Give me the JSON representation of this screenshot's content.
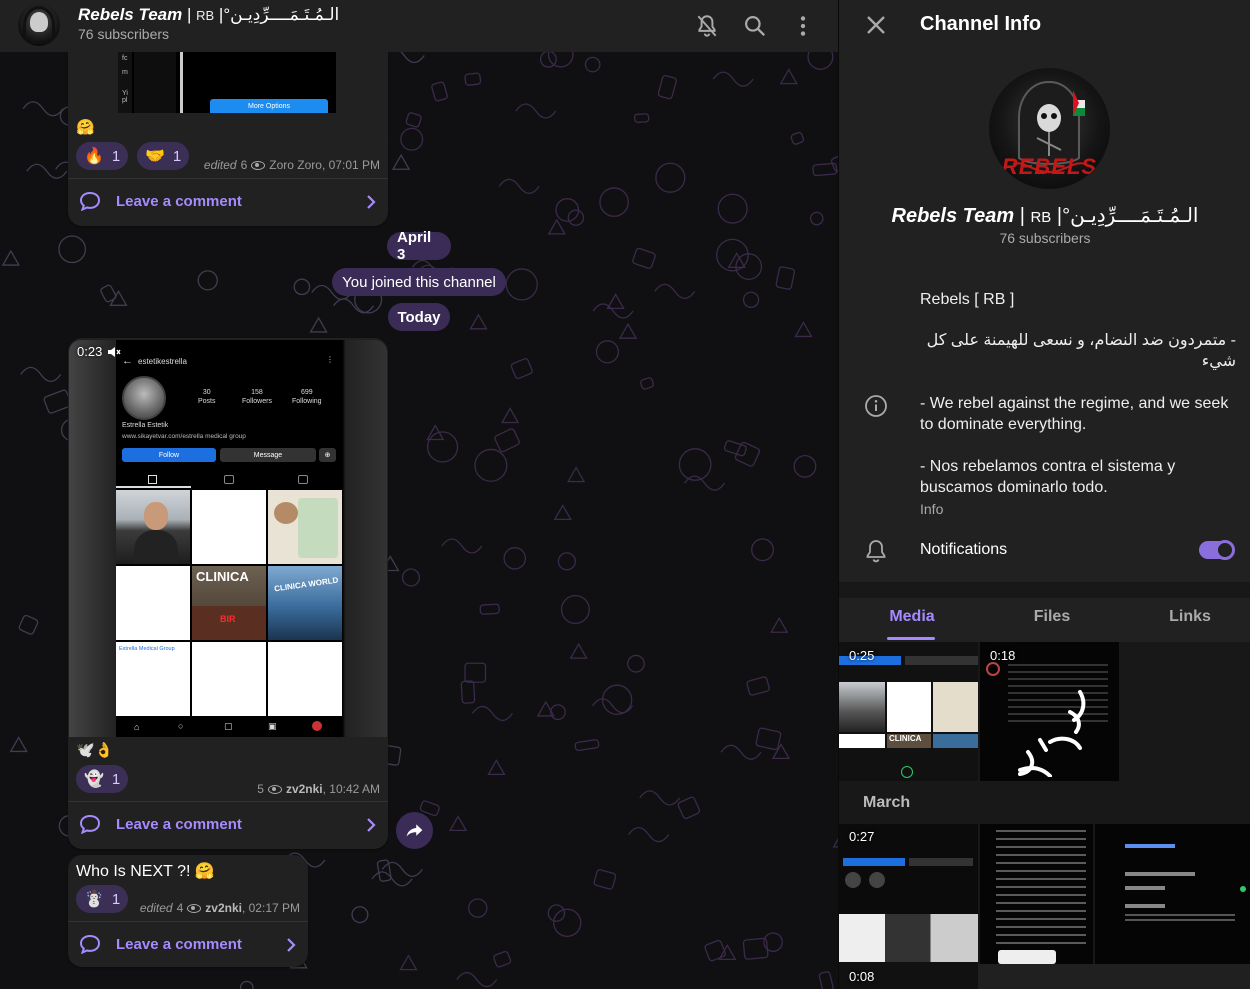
{
  "chat": {
    "title_name": "Rebels Team",
    "title_sep": " | ",
    "title_rb": "RB",
    "title_arabic": " |°الـمُـتَـمَــــرِّدِيـن",
    "subscribers": "76 subscribers"
  },
  "messages": {
    "m1": {
      "emoji": "🤗",
      "reactions": [
        {
          "emoji": "🔥",
          "count": "1"
        },
        {
          "emoji": "🤝",
          "count": "1"
        }
      ],
      "edited": "edited",
      "views": "6",
      "author": "Zoro Zoro",
      "time": ", 07:01 PM",
      "comment": "Leave a comment",
      "media_button": "More Options"
    },
    "date_april": "April 3",
    "joined": "You joined this channel",
    "date_today": "Today",
    "m2": {
      "duration": "0:23",
      "emoji": "🕊️👌",
      "reactions": [
        {
          "emoji": "👻",
          "count": "1"
        }
      ],
      "views": "5",
      "author": "zv2nki",
      "time": ", 10:42 AM",
      "comment": "Leave a comment",
      "phone": {
        "username": "estetikestrella",
        "posts_n": "30",
        "posts_l": "Posts",
        "followers_n": "158",
        "followers_l": "Followers",
        "following_n": "699",
        "following_l": "Following",
        "profile_name": "Estrella Estetik",
        "link": "www.sikayetvar.com/estrella medical group",
        "follow": "Follow",
        "message": "Message",
        "clinic1": "CLINICA",
        "clinic2": "CLINICA WORLD",
        "bir": "BIR",
        "group": "Estrella Medical Group"
      }
    },
    "m3": {
      "text": "Who Is NEXT ?! 🤗",
      "reactions": [
        {
          "emoji": "☃️",
          "count": "1"
        }
      ],
      "edited": "edited",
      "views": "4",
      "author": "zv2nki",
      "time": ", 02:17 PM",
      "comment": "Leave a comment"
    }
  },
  "panel": {
    "title": "Channel Info",
    "name": "Rebels Team",
    "rb": "RB",
    "arabic": " |°الـمُـتَـمَــــرِّدِيـن",
    "avatar_text": "REBELS",
    "subscribers": "76 subscribers",
    "desc_line1": "Rebels [ RB ]",
    "desc_arabic": "- متمردون ضد النضام، و نسعى للهيمنة على كل شيء",
    "desc_en": "- We rebel against the regime, and we seek to dominate everything.",
    "desc_es": "- Nos rebelamos contra el sistema y buscamos dominarlo todo.",
    "desc_label": "Info",
    "notifications": "Notifications",
    "notifications_on": true,
    "tabs": [
      "Media",
      "Files",
      "Links"
    ],
    "active_tab": "Media",
    "thumb1_duration": "0:25",
    "thumb2_duration": "0:18",
    "month": "March",
    "thumb3_duration": "0:27",
    "thumb4_duration": "0:08"
  },
  "colors": {
    "accent": "#a58bff",
    "reaction_bg": "#3b2f55",
    "bubble": "#212121",
    "header": "#212121",
    "follow_blue": "#1d6fe0"
  }
}
